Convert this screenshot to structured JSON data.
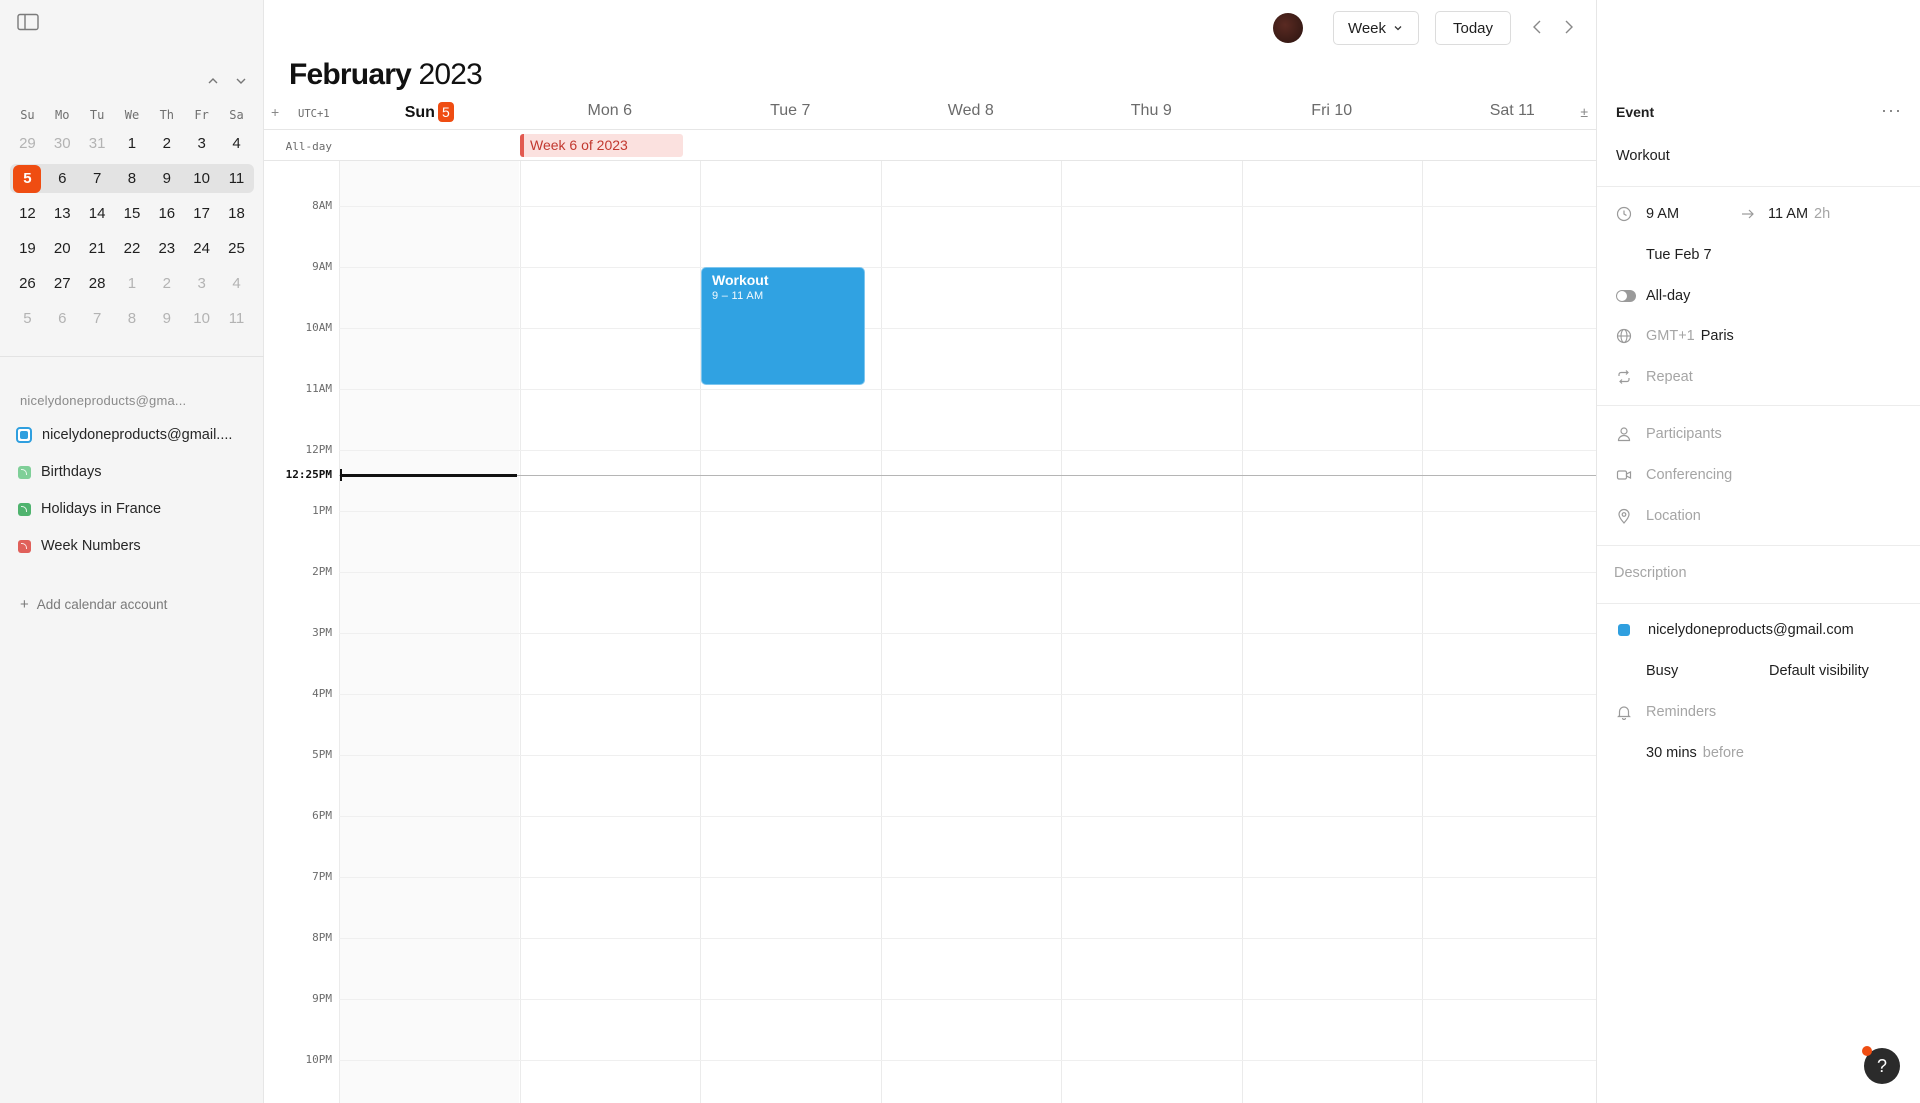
{
  "header": {
    "view_label": "Week",
    "today_label": "Today",
    "month": "February",
    "year": "2023"
  },
  "mini_calendar": {
    "weekdays": [
      "Su",
      "Mo",
      "Tu",
      "We",
      "Th",
      "Fr",
      "Sa"
    ],
    "weeks": [
      [
        {
          "d": "29",
          "m": true
        },
        {
          "d": "30",
          "m": true
        },
        {
          "d": "31",
          "m": true
        },
        {
          "d": "1"
        },
        {
          "d": "2"
        },
        {
          "d": "3"
        },
        {
          "d": "4"
        }
      ],
      [
        {
          "d": "5",
          "today": true
        },
        {
          "d": "6"
        },
        {
          "d": "7"
        },
        {
          "d": "8"
        },
        {
          "d": "9"
        },
        {
          "d": "10"
        },
        {
          "d": "11"
        }
      ],
      [
        {
          "d": "12"
        },
        {
          "d": "13"
        },
        {
          "d": "14"
        },
        {
          "d": "15"
        },
        {
          "d": "16"
        },
        {
          "d": "17"
        },
        {
          "d": "18"
        }
      ],
      [
        {
          "d": "19"
        },
        {
          "d": "20"
        },
        {
          "d": "21"
        },
        {
          "d": "22"
        },
        {
          "d": "23"
        },
        {
          "d": "24"
        },
        {
          "d": "25"
        }
      ],
      [
        {
          "d": "26"
        },
        {
          "d": "27"
        },
        {
          "d": "28"
        },
        {
          "d": "1",
          "m": true
        },
        {
          "d": "2",
          "m": true
        },
        {
          "d": "3",
          "m": true
        },
        {
          "d": "4",
          "m": true
        }
      ],
      [
        {
          "d": "5",
          "m": true
        },
        {
          "d": "6",
          "m": true
        },
        {
          "d": "7",
          "m": true
        },
        {
          "d": "8",
          "m": true
        },
        {
          "d": "9",
          "m": true
        },
        {
          "d": "10",
          "m": true
        },
        {
          "d": "11",
          "m": true
        }
      ]
    ],
    "highlight_week_index": 1
  },
  "sidebar": {
    "account_label": "nicelydoneproducts@gma...",
    "calendars": [
      {
        "label": "nicelydoneproducts@gmail....",
        "color": "#2f9fdf",
        "kind": "main"
      },
      {
        "label": "Birthdays",
        "color": "#7fcf98",
        "kind": "feed"
      },
      {
        "label": "Holidays in France",
        "color": "#4fb36e",
        "kind": "feed"
      },
      {
        "label": "Week Numbers",
        "color": "#e0605a",
        "kind": "feed"
      }
    ],
    "add_account_label": "Add calendar account"
  },
  "week": {
    "timezone": "UTC+1",
    "add_symbol": "+",
    "collapse_symbol": "±",
    "days": [
      {
        "name": "Sun",
        "num": "5",
        "today": true
      },
      {
        "name": "Mon",
        "num": "6"
      },
      {
        "name": "Tue",
        "num": "7"
      },
      {
        "name": "Wed",
        "num": "8"
      },
      {
        "name": "Thu",
        "num": "9"
      },
      {
        "name": "Fri",
        "num": "10"
      },
      {
        "name": "Sat",
        "num": "11"
      }
    ],
    "allday_label": "All-day",
    "allday_event": "Week 6 of 2023",
    "hours": [
      "8AM",
      "9AM",
      "10AM",
      "11AM",
      "12PM",
      "1PM",
      "2PM",
      "3PM",
      "4PM",
      "5PM",
      "6PM",
      "7PM",
      "8PM",
      "9PM",
      "10PM"
    ],
    "now_label": "12:25PM",
    "event": {
      "title": "Workout",
      "time": "9 – 11 AM"
    }
  },
  "panel": {
    "heading": "Event",
    "more": "···",
    "title": "Workout",
    "start_time": "9 AM",
    "end_time": "11 AM",
    "duration": "2h",
    "date": "Tue Feb 7",
    "allday_label": "All-day",
    "timezone_offset": "GMT+1",
    "timezone_city": "Paris",
    "repeat": "Repeat",
    "participants": "Participants",
    "conferencing": "Conferencing",
    "location": "Location",
    "description": "Description",
    "calendar": "nicelydoneproducts@gmail.com",
    "calendar_color": "#2f9fdf",
    "availability": "Busy",
    "visibility": "Default visibility",
    "reminders": "Reminders",
    "reminder_value": "30 mins",
    "reminder_suffix": "before"
  },
  "help": "?"
}
